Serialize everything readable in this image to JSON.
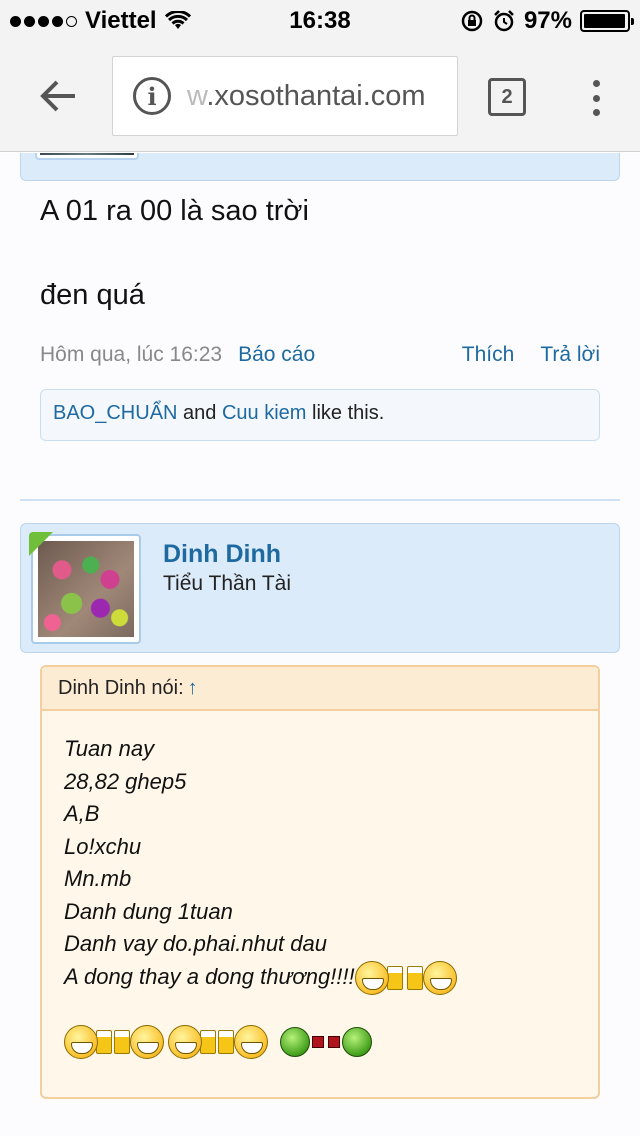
{
  "status_bar": {
    "carrier": "Viettel",
    "time": "16:38",
    "battery": "97%",
    "battery_level": 0.97
  },
  "browser": {
    "url_faded": "w",
    "url": ".xosothantai.com",
    "tab_count": "2"
  },
  "previous_post": {
    "lines": [
      "A 01 ra 00 là sao trời",
      "đen quá"
    ],
    "time": "Hôm qua, lúc 16:23",
    "report": "Báo cáo",
    "like": "Thích",
    "reply": "Trả lời",
    "likes": {
      "user1": "BAO_CHUẨN",
      "and": "and",
      "user2": "Cuu kiem",
      "suffix": "like this."
    }
  },
  "post": {
    "user_name": "Dinh Dinh",
    "user_title": "Tiểu Thần Tài",
    "quote_author": "Dinh Dinh nói:",
    "quote_arrow": "↑",
    "quote_lines": [
      "Tuan nay",
      "28,82 ghep5",
      "A,B",
      "Lo!xchu",
      "Mn.mb",
      "Danh dung 1tuan",
      "Danh vay do.phai.nhut dau",
      "A dong thay a dong thương!!!!"
    ]
  }
}
